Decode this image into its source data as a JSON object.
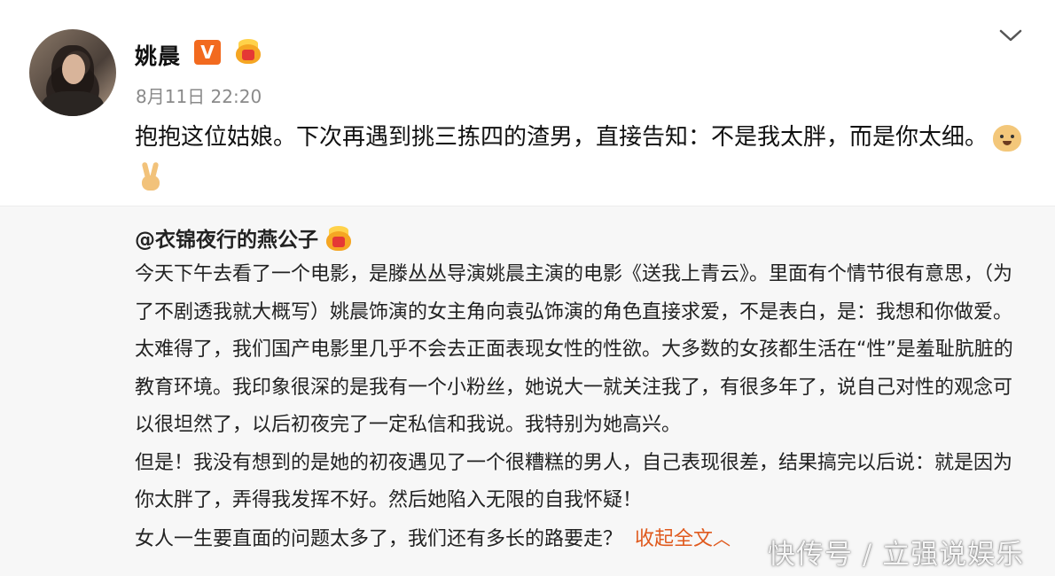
{
  "post": {
    "username": "姚晨",
    "vip_badge": "V",
    "timestamp": "8月11日 22:20",
    "text": "抱抱这位姑娘。下次再遇到挑三拣四的渣男，直接告知：不是我太胖，而是你太细。"
  },
  "repost": {
    "username": "@衣锦夜行的燕公子",
    "paragraphs": [
      "今天下午去看了一个电影，是滕丛丛导演姚晨主演的电影《送我上青云》。里面有个情节很有意思，（为了不剧透我就大概写）姚晨饰演的女主角向袁弘饰演的角色直接求爱，不是表白，是：我想和你做爱。",
      "太难得了，我们国产电影里几乎不会去正面表现女性的性欲。大多数的女孩都生活在“性”是羞耻肮脏的教育环境。我印象很深的是我有一个小粉丝，她说大一就关注我了，有很多年了，说自己对性的观念可以很坦然了，以后初夜完了一定私信和我说。我特别为她高兴。",
      "但是！我没有想到的是她的初夜遇见了一个很糟糕的男人，自己表现很差，结果搞完以后说：就是因为你太胖了，弄得我发挥不好。然后她陷入无限的自我怀疑！"
    ],
    "last_line": "女人一生要直面的问题太多了，我们还有多长的路要走？",
    "collapse_label": "收起全文",
    "collapse_chevron": "︿"
  },
  "watermark": "快传号 / 立强说娱乐",
  "icons": {
    "verified": "vip-v-badge",
    "member": "crown-icon",
    "menu": "chevron-down-icon",
    "emoji1": "doge-emoji",
    "emoji2": "victory-hand-emoji"
  },
  "colors": {
    "accent": "#e05a1e",
    "vip_badge": "#f26a1f",
    "repost_bg": "#f7f7f7",
    "timestamp": "#8a8a8a"
  }
}
